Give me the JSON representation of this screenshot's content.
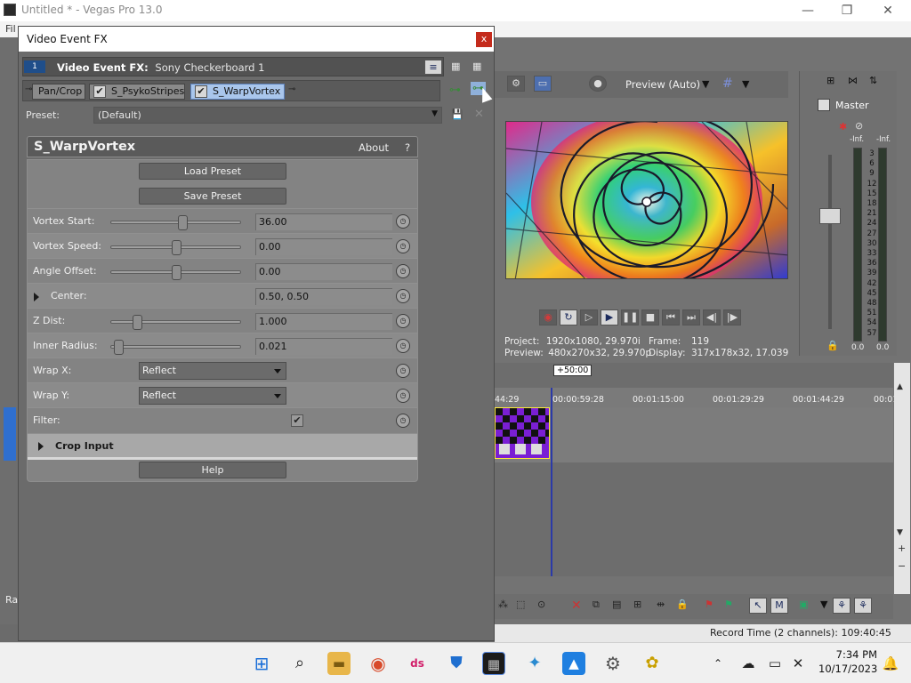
{
  "window": {
    "title": "Untitled * - Vegas Pro 13.0",
    "menu_first": "Fil",
    "minimize": "—",
    "restore": "❐",
    "close": "✕"
  },
  "dialog": {
    "title": "Video Event FX",
    "close": "x",
    "chain_num": "1",
    "chain_label": "Video Event FX:",
    "chain_value": "Sony Checkerboard 1",
    "tabs": [
      {
        "label": "Pan/Crop"
      },
      {
        "label": "S_PsykoStripes"
      },
      {
        "label": "S_WarpVortex"
      }
    ],
    "preset_label": "Preset:",
    "preset_value": "(Default)"
  },
  "plugin": {
    "name": "S_WarpVortex",
    "about": "About",
    "help_q": "?",
    "load_preset": "Load Preset",
    "save_preset": "Save Preset",
    "help": "Help",
    "params": [
      {
        "label": "Vortex Start:",
        "value": "36.00",
        "slider": 0.55
      },
      {
        "label": "Vortex Speed:",
        "value": "0.00",
        "slider": 0.5
      },
      {
        "label": "Angle Offset:",
        "value": "0.00",
        "slider": 0.5
      },
      {
        "label": "Center:",
        "value": "0.50, 0.50"
      },
      {
        "label": "Z Dist:",
        "value": "1.000",
        "slider": 0.18
      },
      {
        "label": "Inner Radius:",
        "value": "0.021",
        "slider": 0.02
      },
      {
        "label": "Wrap X:",
        "value": "Reflect"
      },
      {
        "label": "Wrap Y:",
        "value": "Reflect"
      },
      {
        "label": "Filter:",
        "checked": true
      },
      {
        "label": "Crop Input"
      }
    ]
  },
  "preview": {
    "quality": "Preview (Auto)",
    "project_label": "Project:",
    "project_value": "1920x1080, 29.970i",
    "frame_label": "Frame:",
    "frame_value": "119",
    "preview_label": "Preview:",
    "preview_value": "480x270x32, 29.970p",
    "display_label": "Display:",
    "display_value": "317x178x32, 17.039"
  },
  "mixer": {
    "title": "Master",
    "left_peak": "-Inf.",
    "right_peak": "-Inf.",
    "scale": [
      "3",
      "6",
      "9",
      "12",
      "15",
      "18",
      "21",
      "24",
      "27",
      "30",
      "33",
      "36",
      "39",
      "42",
      "45",
      "48",
      "51",
      "54",
      "57"
    ],
    "left_bottom": "0.0",
    "right_bottom": "0.0"
  },
  "timeline": {
    "rate": "+50:00",
    "ruler": [
      "44:29",
      "00:00:59:28",
      "00:01:15:00",
      "00:01:29:29",
      "00:01:44:29",
      "00:01"
    ]
  },
  "status": {
    "record_time": "Record Time (2 channels): 109:40:45",
    "left_fragment": "Ra"
  },
  "taskbar": {
    "time": "7:34 PM",
    "date": "10/17/2023"
  }
}
